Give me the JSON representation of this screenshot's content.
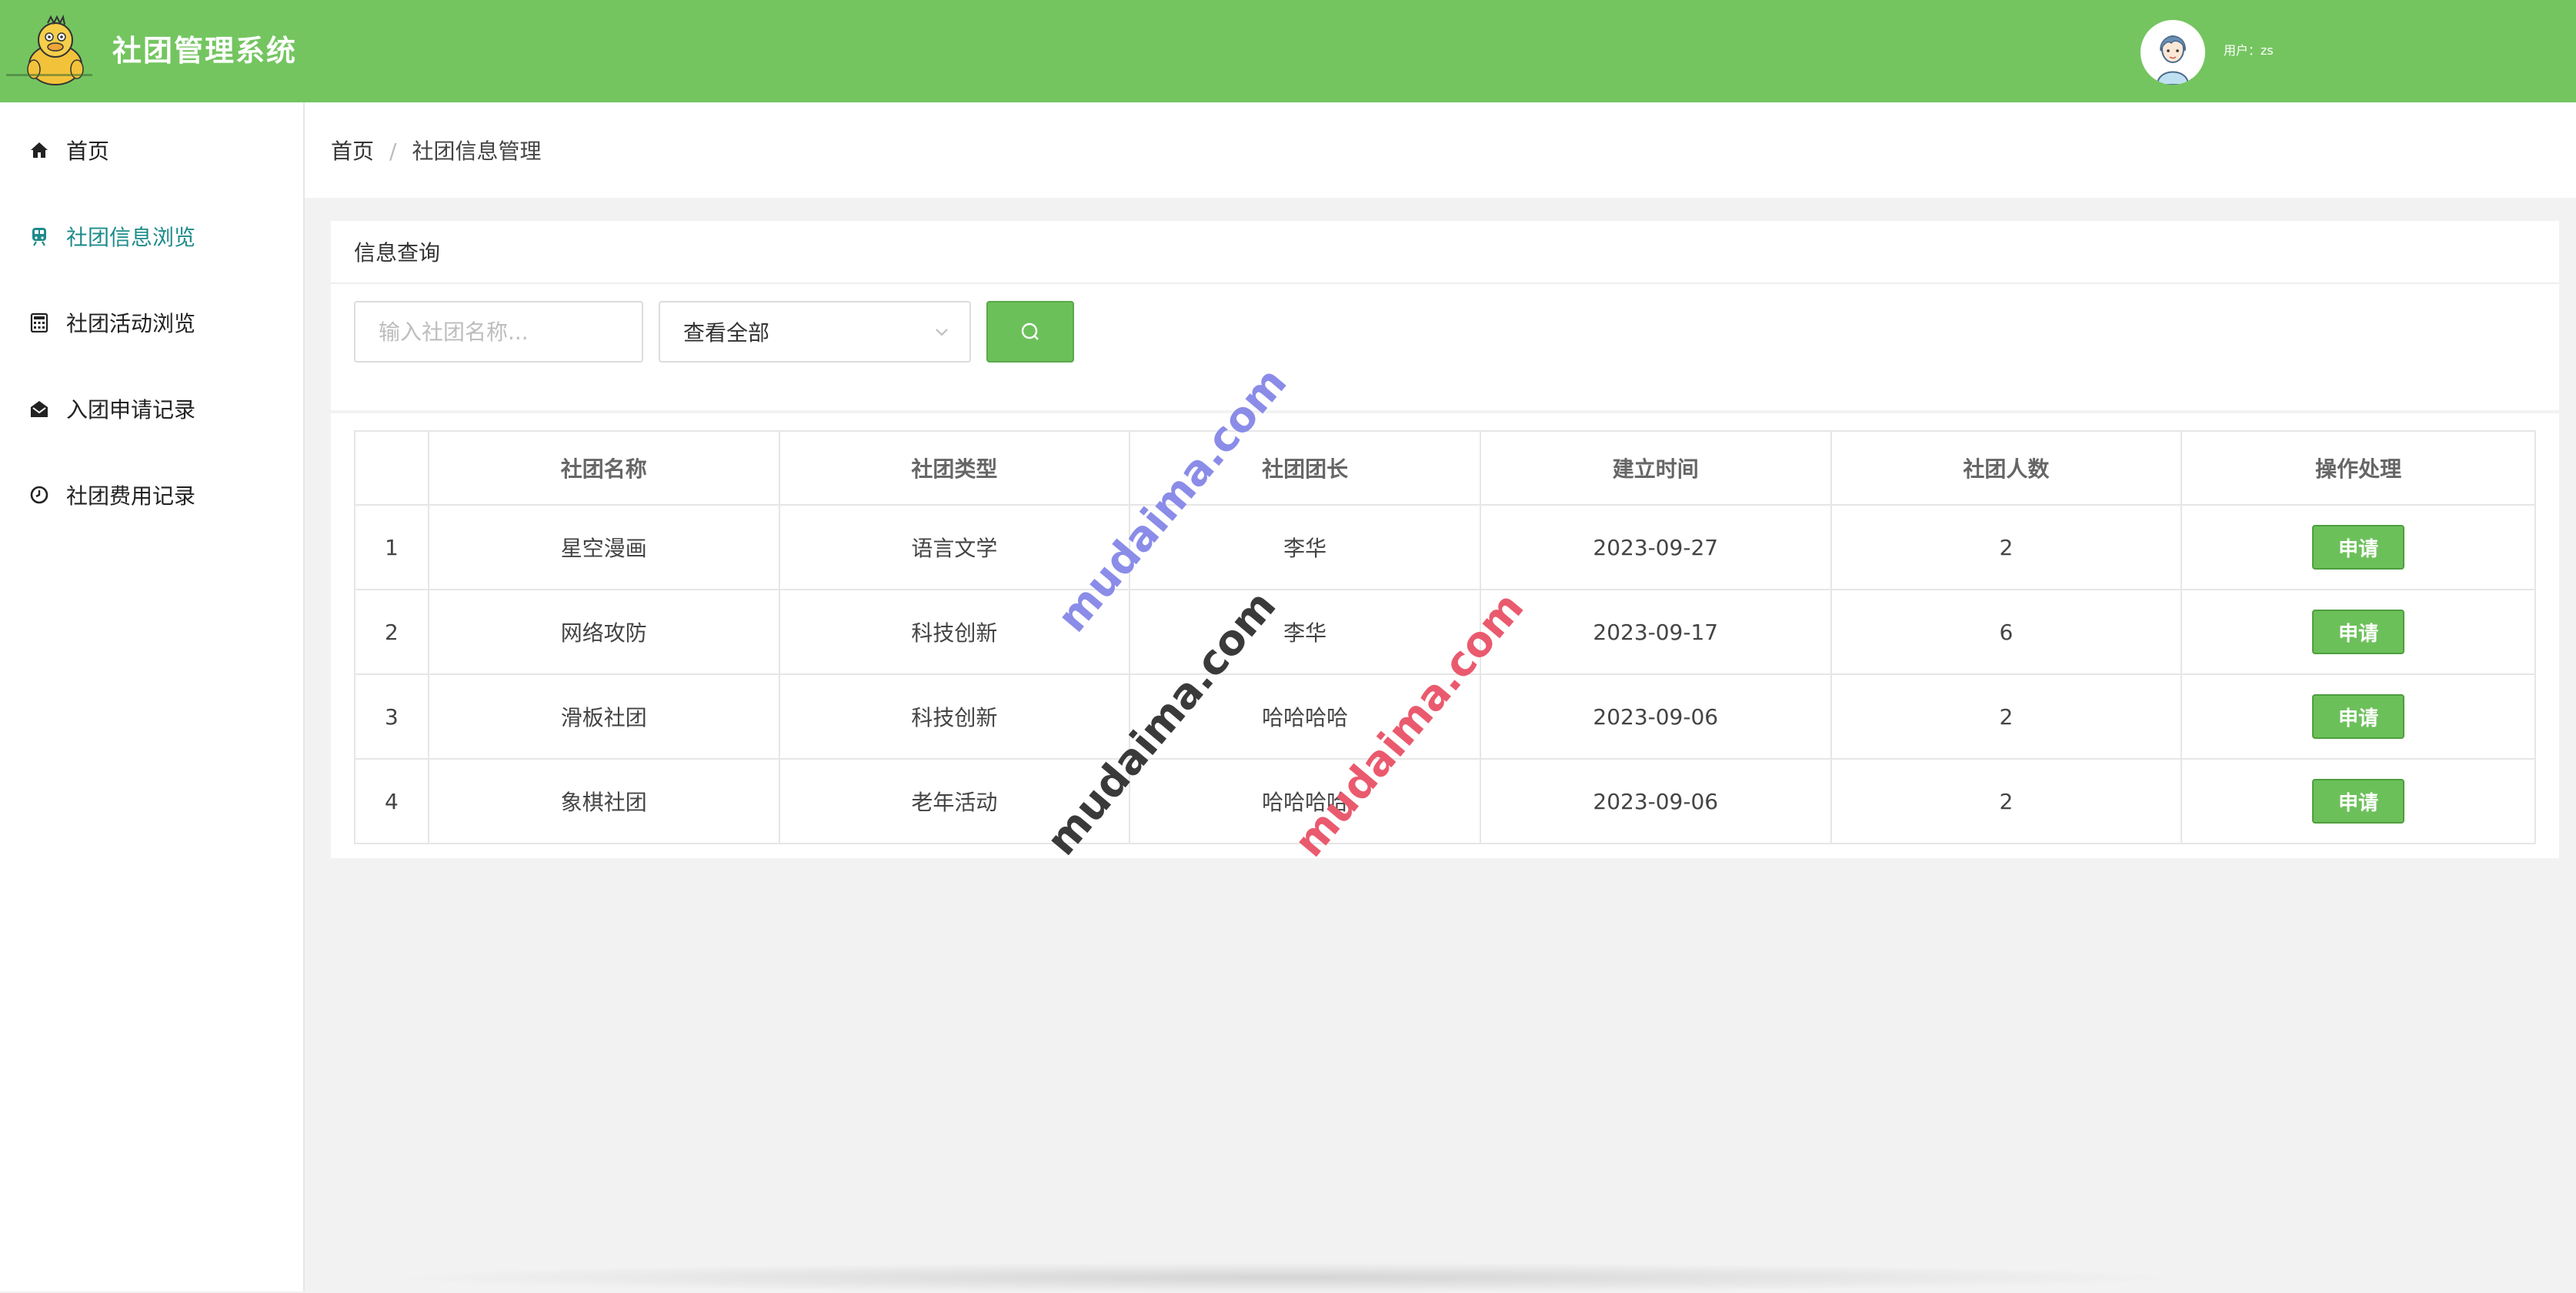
{
  "header": {
    "app_title": "社团管理系统",
    "user_label": "用户：zs",
    "brand_color": "#74c560"
  },
  "sidebar": {
    "items": [
      {
        "label": "首页",
        "icon": "home-icon"
      },
      {
        "label": "社团信息浏览",
        "icon": "train-icon",
        "active": true
      },
      {
        "label": "社团活动浏览",
        "icon": "calculator-icon"
      },
      {
        "label": "入团申请记录",
        "icon": "envelope-open-icon"
      },
      {
        "label": "社团费用记录",
        "icon": "clock-icon"
      }
    ],
    "active_color": "#1e8b8b"
  },
  "breadcrumb": {
    "home": "首页",
    "separator": "/",
    "current": "社团信息管理"
  },
  "query": {
    "title": "信息查询",
    "search_placeholder": "输入社团名称...",
    "type_select_value": "查看全部",
    "search_icon": "search-icon"
  },
  "table": {
    "columns": [
      "",
      "社团名称",
      "社团类型",
      "社团团长",
      "建立时间",
      "社团人数",
      "操作处理"
    ],
    "rows": [
      {
        "index": "1",
        "name": "星空漫画",
        "type": "语言文学",
        "leader": "李华",
        "date": "2023-09-27",
        "members": "2",
        "action": "申请"
      },
      {
        "index": "2",
        "name": "网络攻防",
        "type": "科技创新",
        "leader": "李华",
        "date": "2023-09-17",
        "members": "6",
        "action": "申请"
      },
      {
        "index": "3",
        "name": "滑板社团",
        "type": "科技创新",
        "leader": "哈哈哈哈",
        "date": "2023-09-06",
        "members": "2",
        "action": "申请"
      },
      {
        "index": "4",
        "name": "象棋社团",
        "type": "老年活动",
        "leader": "哈哈哈哈",
        "date": "2023-09-06",
        "members": "2",
        "action": "申请"
      }
    ],
    "action_color": "#6cc05a"
  },
  "watermarks": [
    "mudaima.com",
    "mudaima.com",
    "mudaima.com"
  ]
}
